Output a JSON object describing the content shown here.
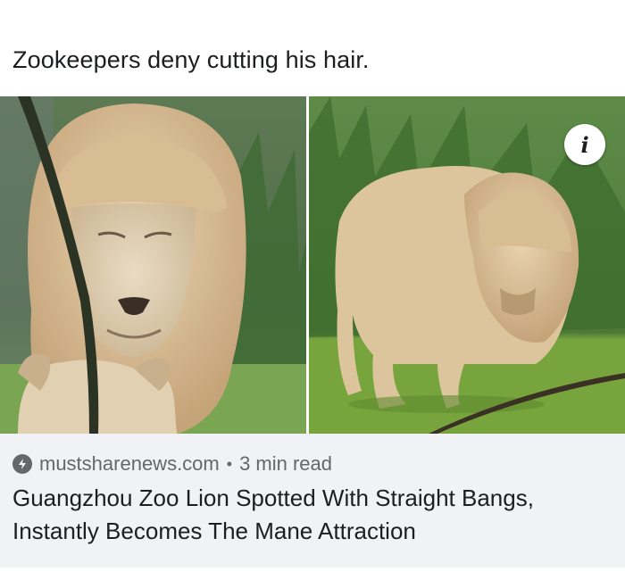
{
  "post": {
    "caption": "Zookeepers deny cutting his hair."
  },
  "link_card": {
    "domain": "mustsharenews.com",
    "separator": "•",
    "read_time": "3 min read",
    "title_line1": "Guangzhou Zoo Lion Spotted With Straight Bangs,",
    "title_line2": "Instantly Becomes The Mane Attraction",
    "info_icon": "info-icon",
    "source_icon": "lightning-bolt-icon"
  },
  "colors": {
    "card_bg": "#f0f2f5",
    "meta_text": "#65676b",
    "title_text": "#1c1e21"
  }
}
